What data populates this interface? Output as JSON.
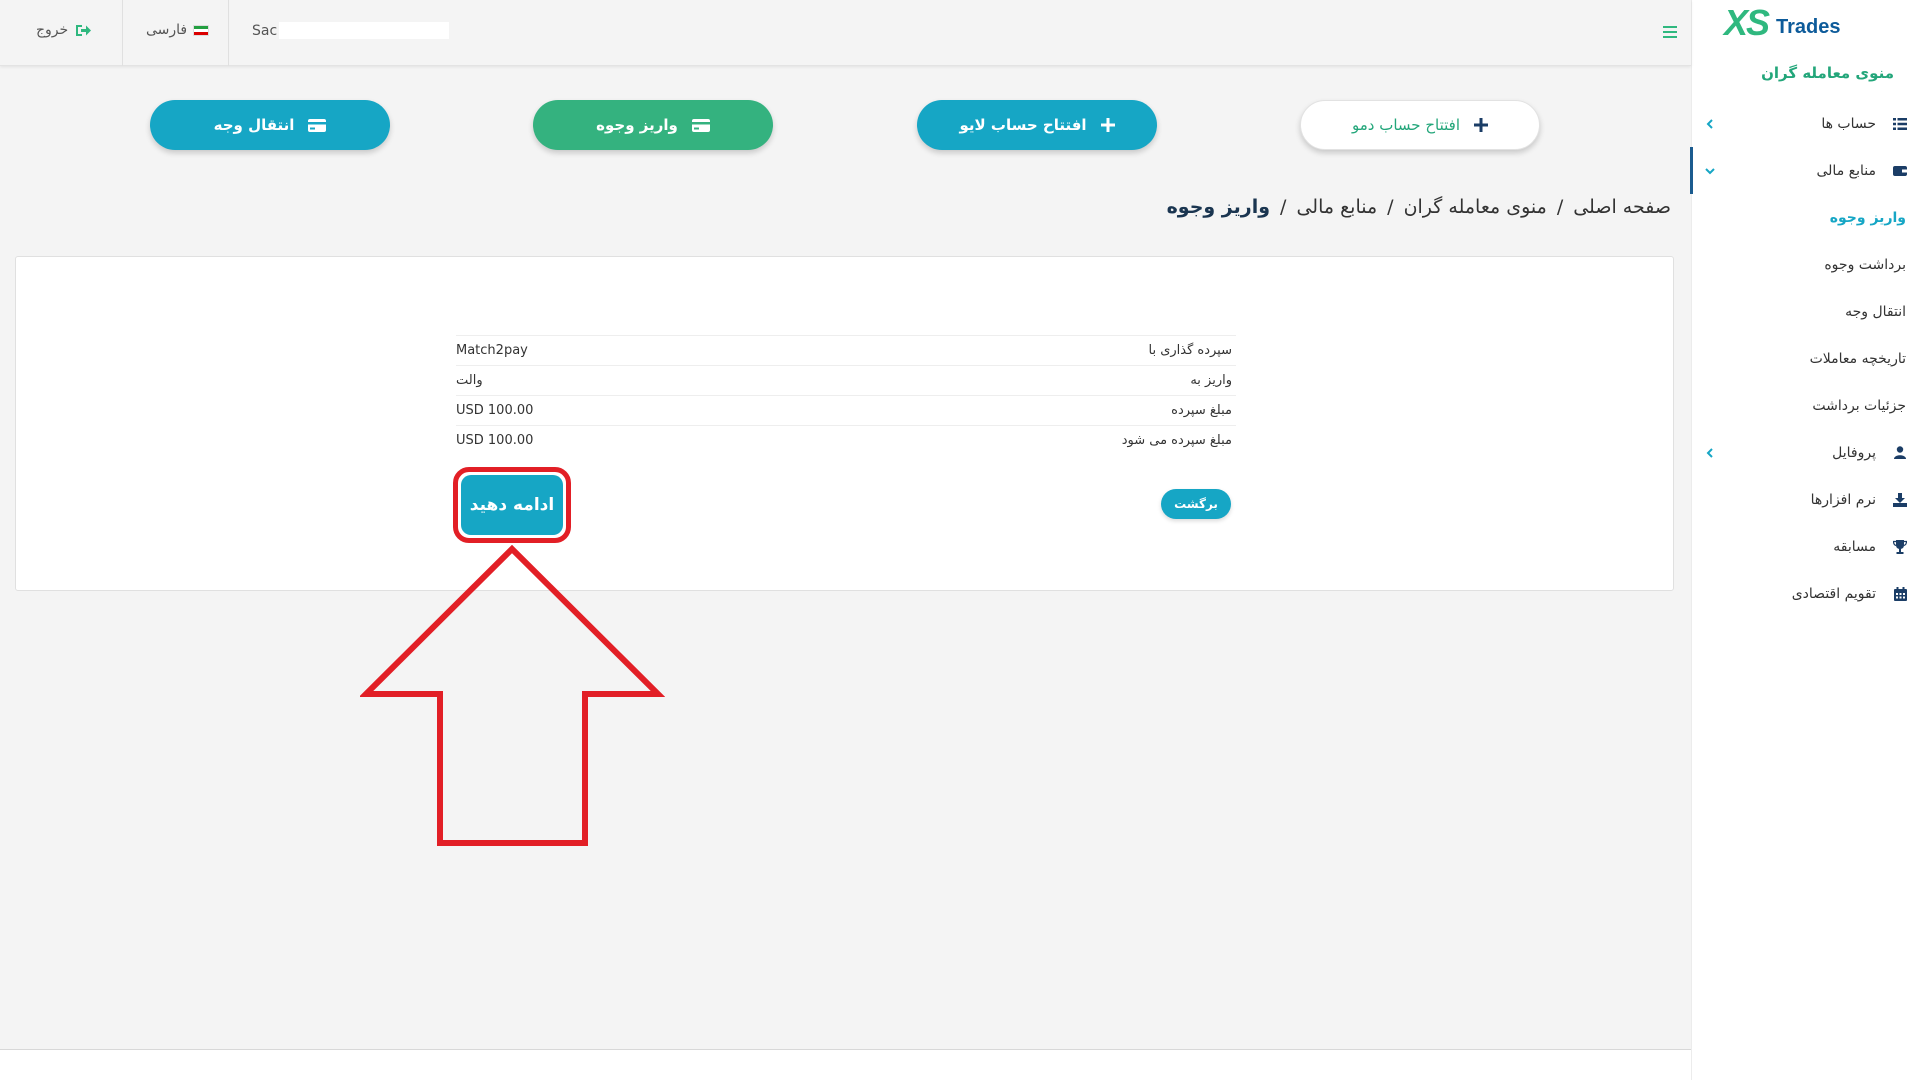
{
  "brand": {
    "logo_xs": "XS",
    "logo_trades": "Trades",
    "accent": "#2fb87f",
    "primary": "#16a6c5",
    "navy": "#0d5b9a"
  },
  "sidebar": {
    "title": "منوی معامله گران",
    "items": [
      {
        "label": "حساب ها",
        "icon": "list-icon"
      },
      {
        "label": "منابع مالی",
        "icon": "wallet-icon"
      },
      {
        "label": "واریز وجوه"
      },
      {
        "label": "برداشت وجوه"
      },
      {
        "label": "انتقال وجه"
      },
      {
        "label": "تاریخچه معاملات"
      },
      {
        "label": "جزئیات برداشت"
      },
      {
        "label": "پروفایل",
        "icon": "user-icon"
      },
      {
        "label": "نرم افزارها",
        "icon": "download-icon"
      },
      {
        "label": "مسابقه",
        "icon": "trophy-icon"
      },
      {
        "label": "تقویم اقتصادی",
        "icon": "calendar-icon"
      }
    ]
  },
  "topbar": {
    "logout_label": "خروج",
    "language_label": "فارسی",
    "user_prefix": "Sac"
  },
  "actions": {
    "demo": "افتتاح حساب دمو",
    "live": "افتتاح حساب لایو",
    "deposit": "واریز وجوه",
    "transfer": "انتقال وجه"
  },
  "breadcrumb": {
    "home": "صفحه اصلی",
    "traders_menu": "منوی معامله گران",
    "finance": "منابع مالی",
    "current": "واریز وجوه",
    "separator": "/"
  },
  "summary": {
    "rows": [
      {
        "label": "سپرده گذاری با",
        "value": "Match2pay"
      },
      {
        "label": "واریز به",
        "value": "والت"
      },
      {
        "label": "مبلغ سپرده",
        "value": "USD 100.00"
      },
      {
        "label": "مبلغ سپرده می شود",
        "value": "USD 100.00"
      }
    ],
    "back_label": "برگشت",
    "continue_label": "ادامه دهید"
  },
  "annotation": {
    "color": "#e21f26"
  }
}
